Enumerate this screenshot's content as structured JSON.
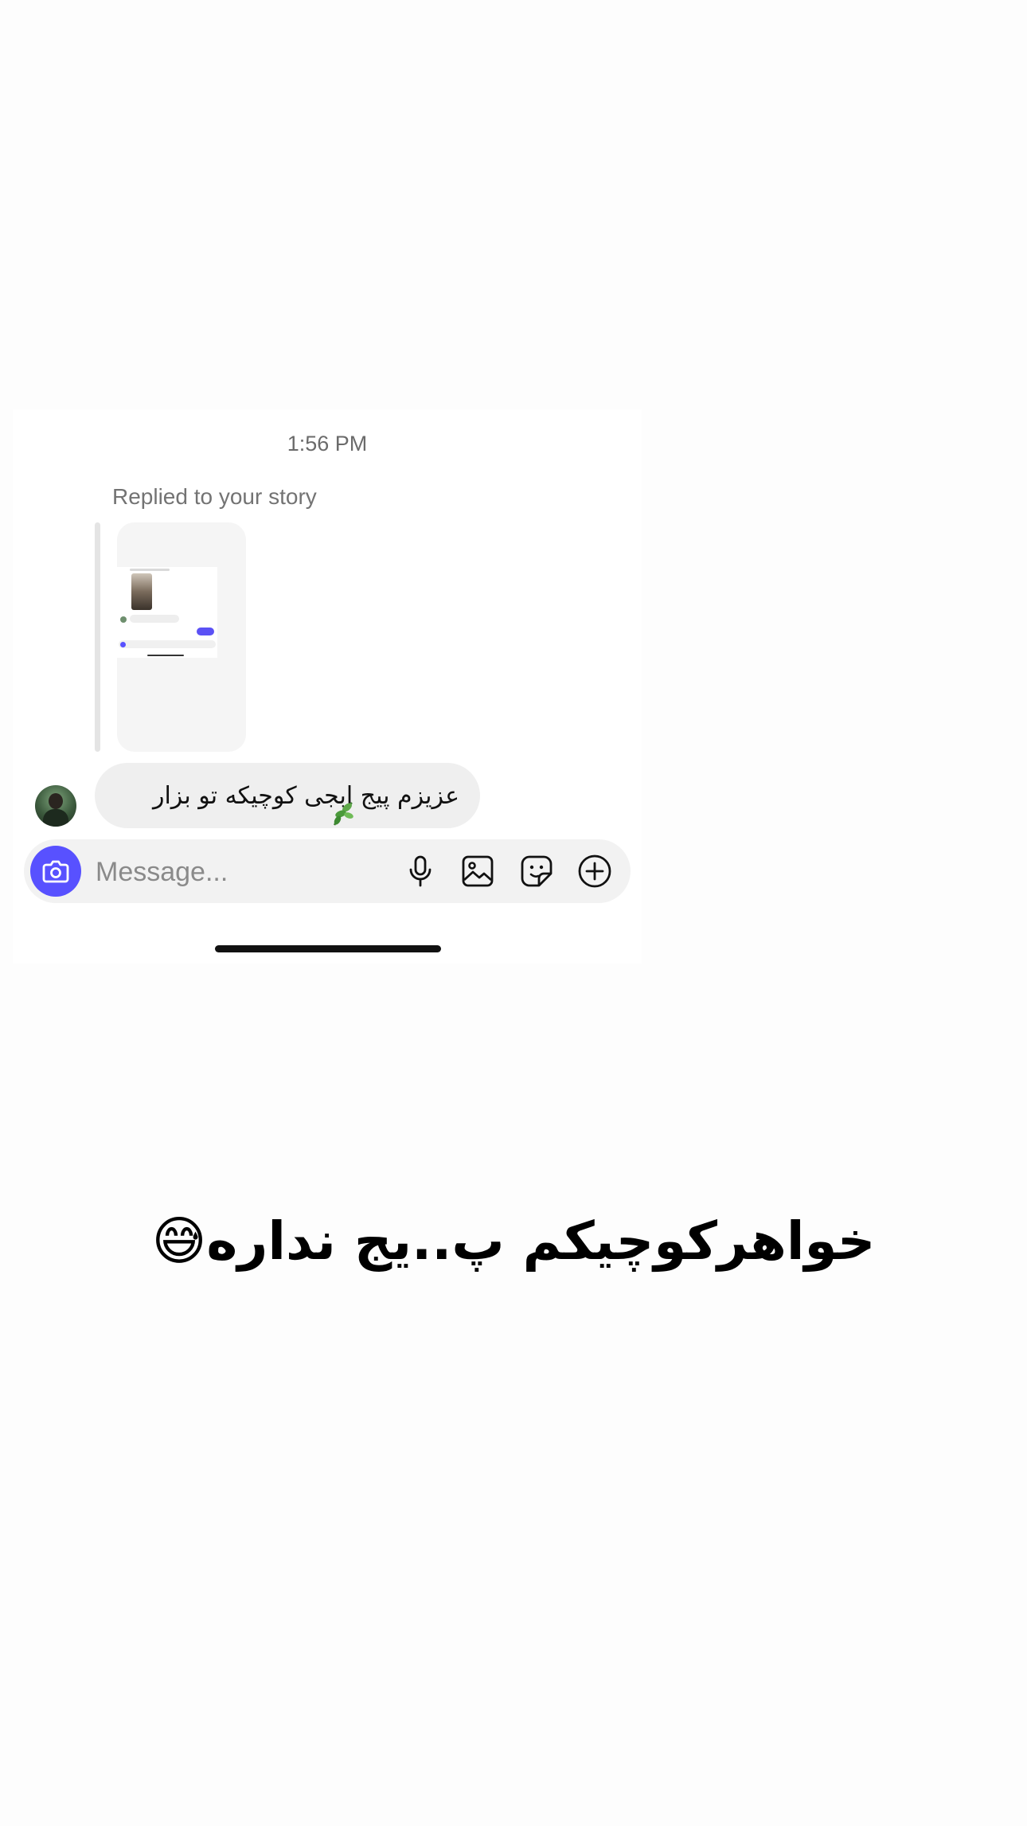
{
  "chat": {
    "timestamp": "1:56 PM",
    "reply_label": "Replied to your story",
    "message": "عزیزم پیج ابجی کوچیکه تو بزار"
  },
  "composer": {
    "placeholder": "Message...",
    "icons": [
      "camera-icon",
      "microphone-icon",
      "gallery-icon",
      "sticker-icon",
      "add-circle-icon"
    ]
  },
  "caption": {
    "text": "خواهرکوچیکم پ..یج نداره😅"
  },
  "colors": {
    "accent": "#5851ff",
    "bubble": "#efefef",
    "composer_bg": "#f2f2f2",
    "page_bg": "#fdfdfd",
    "card_bg": "#ffffff"
  }
}
